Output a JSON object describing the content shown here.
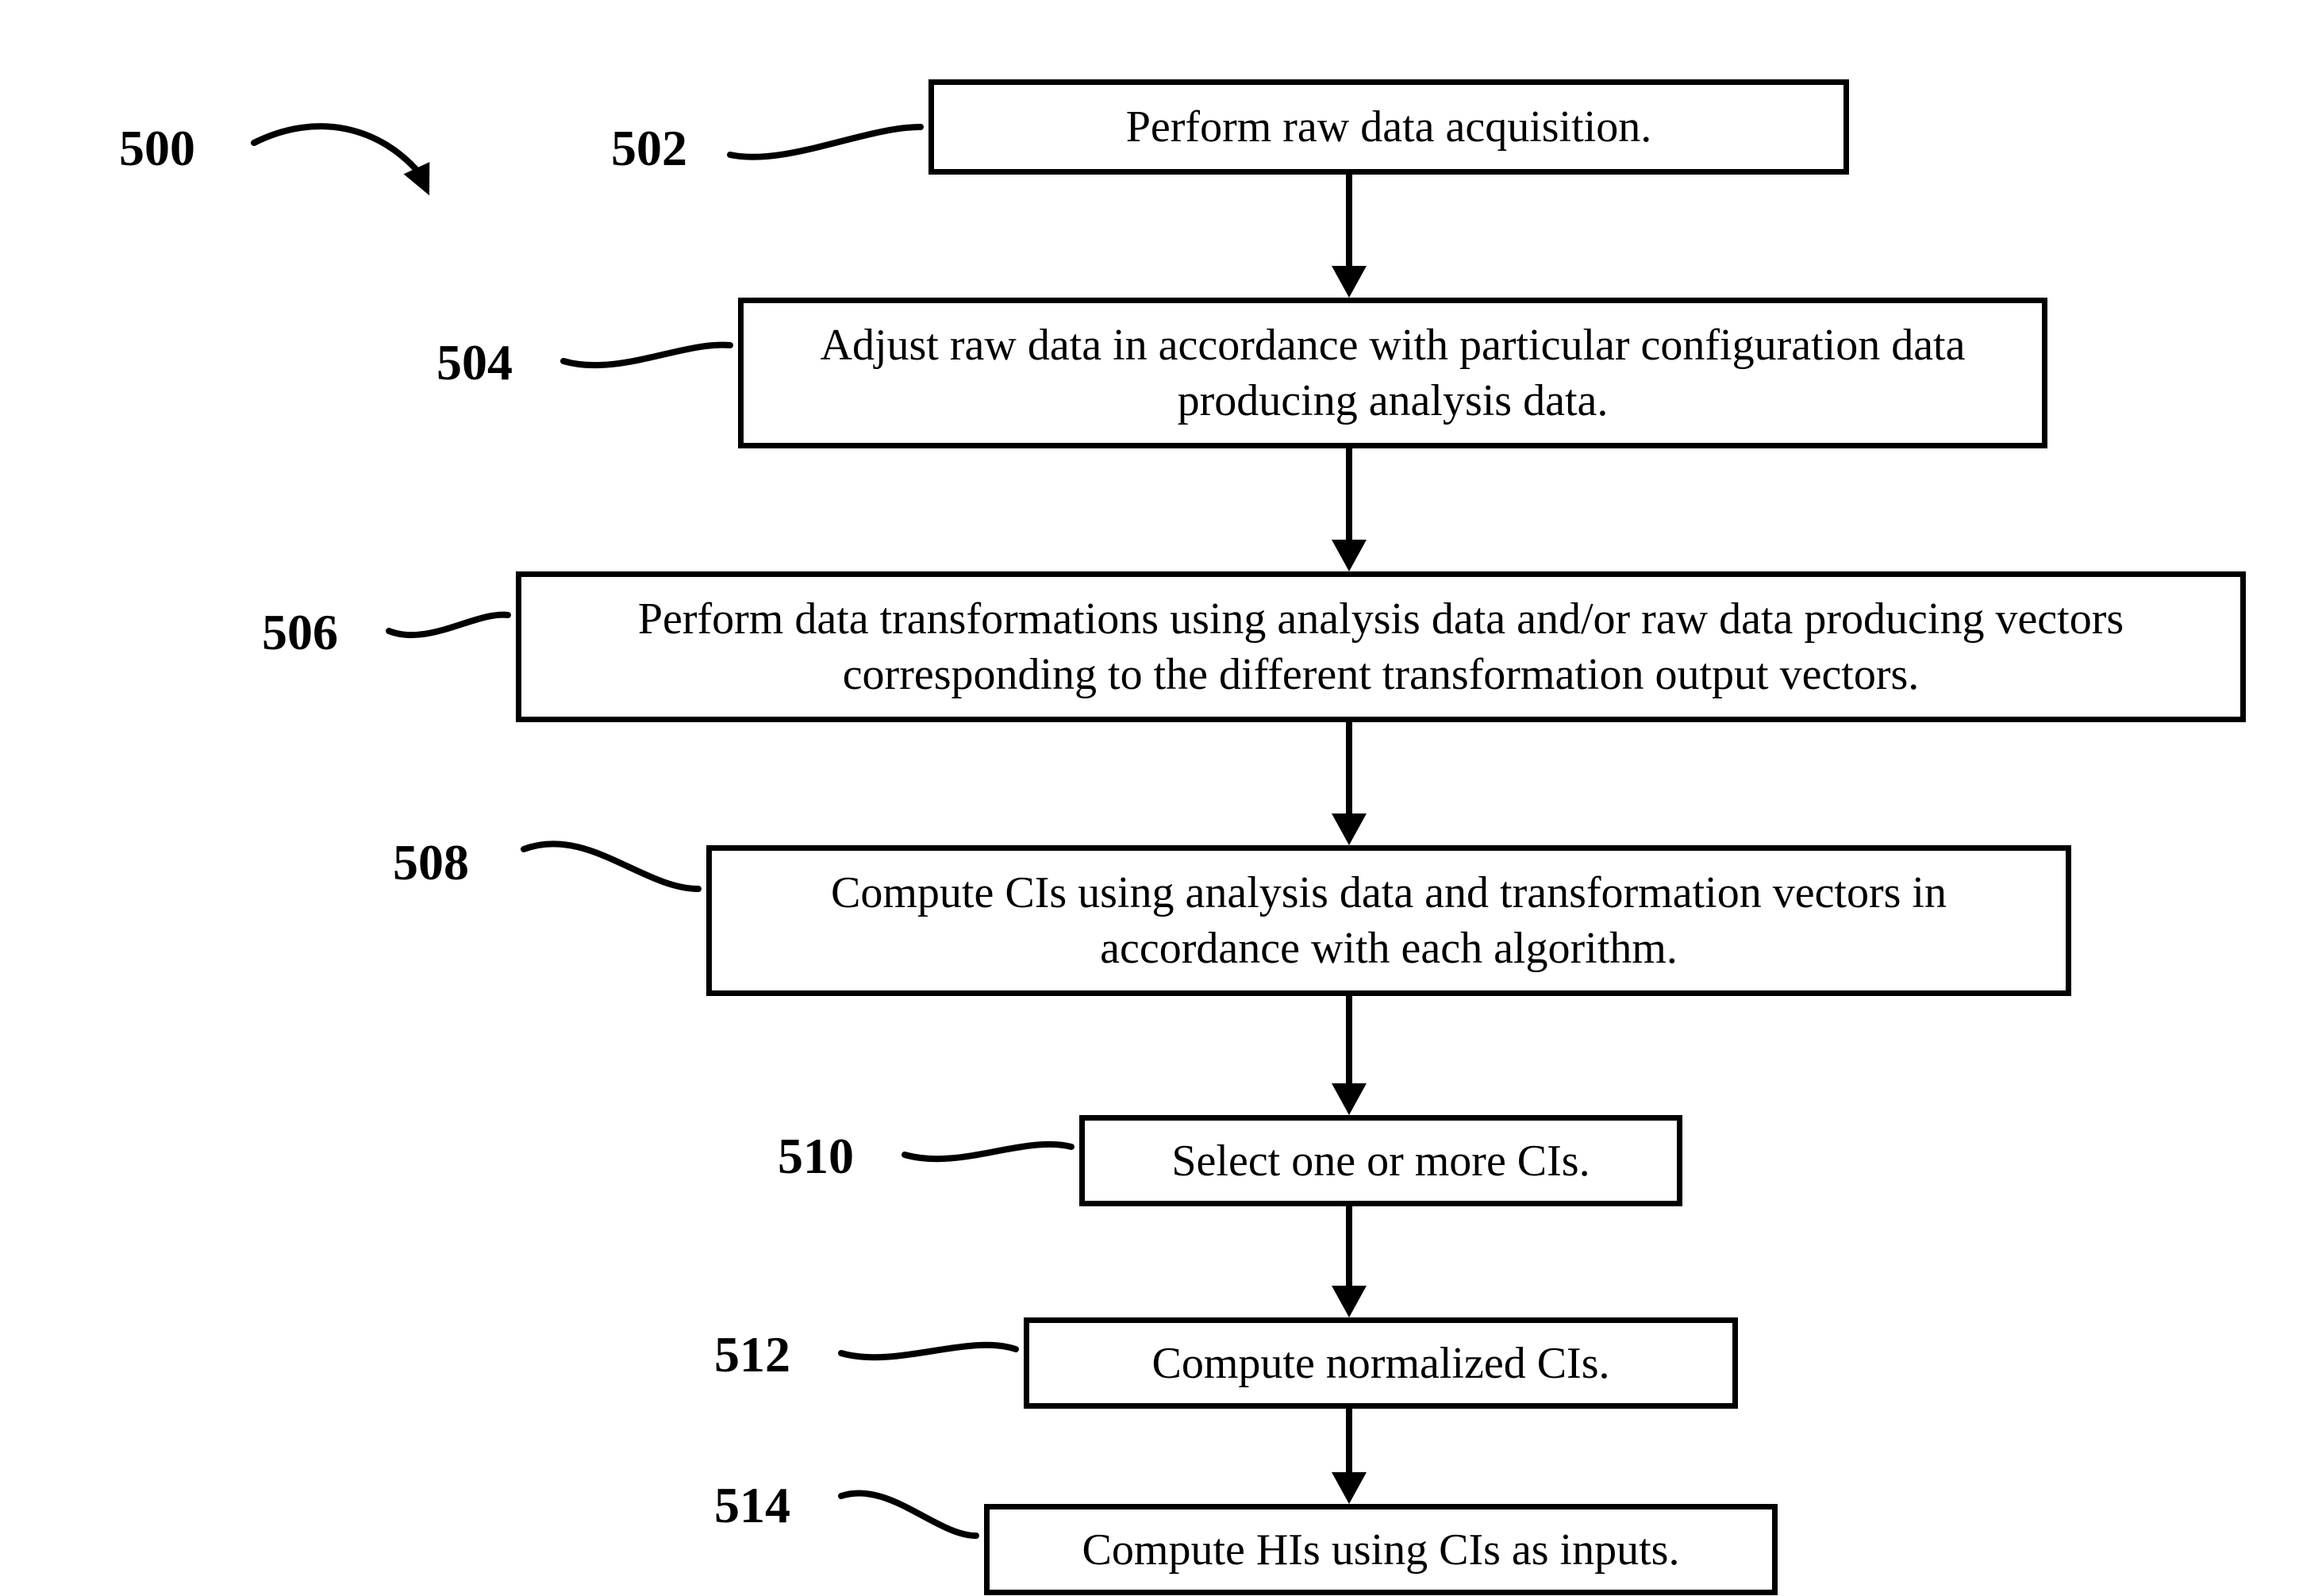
{
  "refs": {
    "r500": "500",
    "r502": "502",
    "r504": "504",
    "r506": "506",
    "r508": "508",
    "r510": "510",
    "r512": "512",
    "r514": "514"
  },
  "steps": {
    "s502": "Perform raw data acquisition.",
    "s504": "Adjust raw data in accordance with particular configuration data producing analysis data.",
    "s506": "Perform data transformations using analysis data and/or raw data producing vectors corresponding to the different transformation output vectors.",
    "s508": "Compute CIs using analysis data and transformation vectors in accordance with each algorithm.",
    "s510": "Select one or more CIs.",
    "s512": "Compute normalized CIs.",
    "s514": "Compute HIs using CIs as inputs."
  }
}
